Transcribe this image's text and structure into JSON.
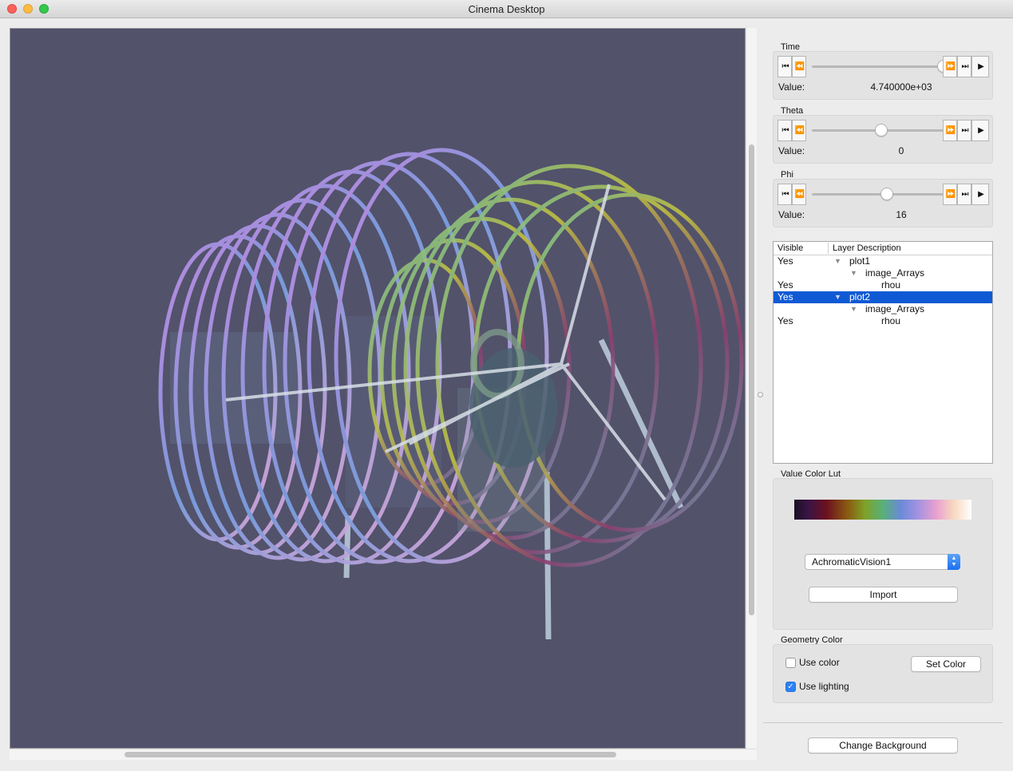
{
  "window": {
    "title": "Cinema Desktop"
  },
  "viewport": {
    "background": "#52526b",
    "content": "3D render"
  },
  "time": {
    "label": "Time",
    "value_label": "Value:",
    "value": "4.740000e+03",
    "slider_fraction": 1.0
  },
  "theta": {
    "label": "Theta",
    "value_label": "Value:",
    "value": "0",
    "slider_fraction": 0.5
  },
  "phi": {
    "label": "Phi",
    "value_label": "Value:",
    "value": "16",
    "slider_fraction": 0.55
  },
  "player_icons": {
    "first": "⏮",
    "prev": "⏪",
    "next": "⏩",
    "last": "⏭",
    "play": "▶"
  },
  "layers": {
    "headers": {
      "visible": "Visible",
      "description": "Layer Description"
    },
    "rows": [
      {
        "visible": "Yes",
        "description": "plot1",
        "indent": 0,
        "expander": "▼",
        "selected": false
      },
      {
        "visible": "",
        "description": "image_Arrays",
        "indent": 1,
        "expander": "▼",
        "selected": false
      },
      {
        "visible": "Yes",
        "description": "rhou",
        "indent": 2,
        "expander": "",
        "selected": false
      },
      {
        "visible": "Yes",
        "description": "plot2",
        "indent": 0,
        "expander": "▼",
        "selected": true
      },
      {
        "visible": "",
        "description": "image_Arrays",
        "indent": 1,
        "expander": "▼",
        "selected": false
      },
      {
        "visible": "Yes",
        "description": "rhou",
        "indent": 2,
        "expander": "",
        "selected": false
      }
    ]
  },
  "lut": {
    "label": "Value Color Lut",
    "selected": "AchromaticVision1",
    "import_label": "Import"
  },
  "geometry": {
    "label": "Geometry Color",
    "use_color_label": "Use color",
    "use_color": false,
    "set_color_label": "Set Color",
    "use_lighting_label": "Use lighting",
    "use_lighting": true
  },
  "change_background_label": "Change Background",
  "check_mark": "✓"
}
